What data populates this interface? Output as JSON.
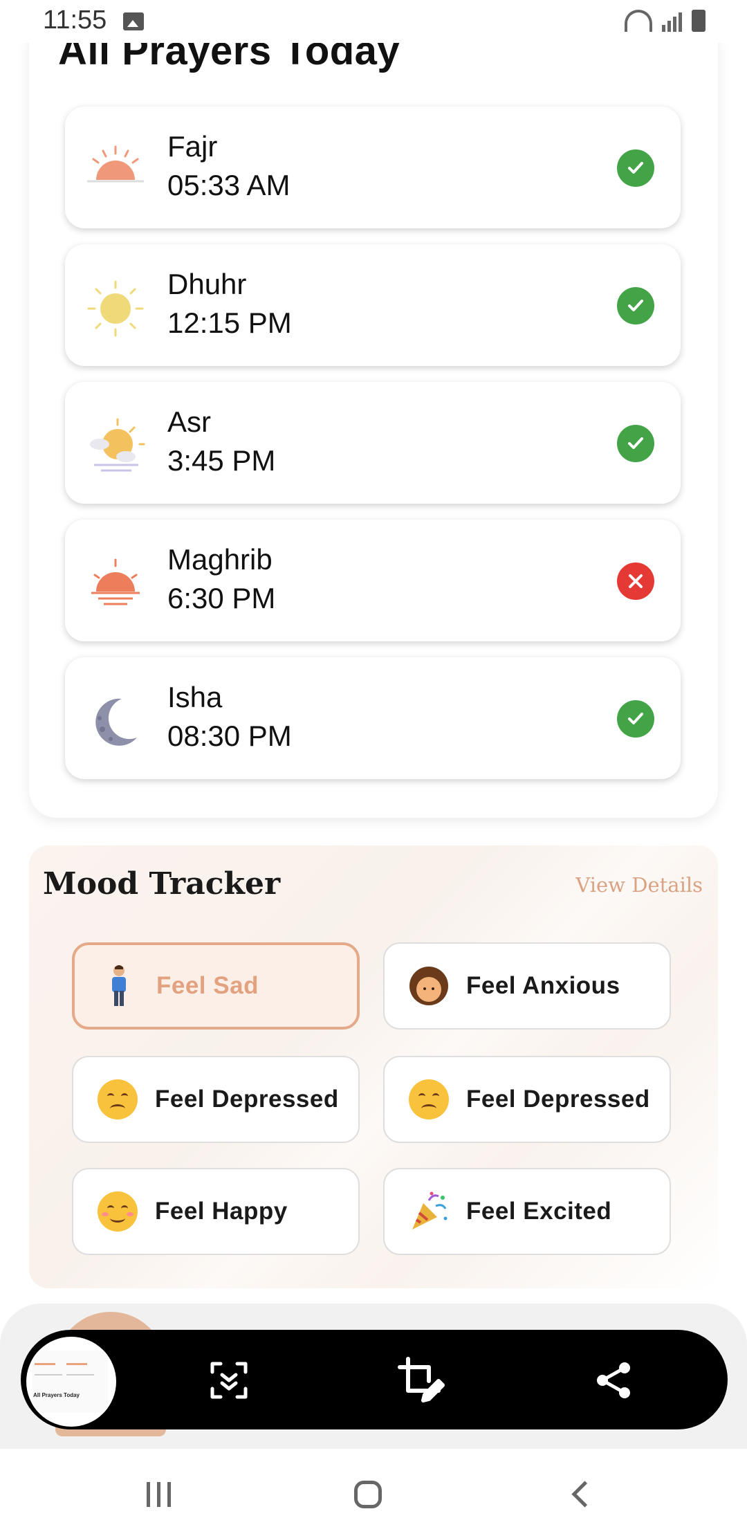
{
  "status_bar": {
    "time": "11:55"
  },
  "prayers": {
    "title": "All Prayers Today",
    "items": [
      {
        "name": "Fajr",
        "time": "05:33 AM",
        "icon": "sunrise-icon",
        "status": "done"
      },
      {
        "name": "Dhuhr",
        "time": "12:15 PM",
        "icon": "sun-icon",
        "status": "done"
      },
      {
        "name": "Asr",
        "time": "3:45 PM",
        "icon": "sun-cloud-icon",
        "status": "done"
      },
      {
        "name": "Maghrib",
        "time": "6:30 PM",
        "icon": "sunset-icon",
        "status": "missed"
      },
      {
        "name": "Isha",
        "time": "08:30 PM",
        "icon": "moon-icon",
        "status": "done"
      }
    ]
  },
  "mood": {
    "title": "Mood Tracker",
    "view_details": "View Details",
    "options": [
      {
        "label": "Feel Sad",
        "emoji": "person-standing-icon",
        "selected": true
      },
      {
        "label": "Feel Anxious",
        "emoji": "person-face-icon",
        "selected": false
      },
      {
        "label": "Feel Depressed",
        "emoji": "disappointed-face-icon",
        "selected": false
      },
      {
        "label": "Feel Depressed",
        "emoji": "disappointed-face-icon",
        "selected": false
      },
      {
        "label": "Feel Happy",
        "emoji": "smiling-face-icon",
        "selected": false
      },
      {
        "label": "Feel Excited",
        "emoji": "party-popper-icon",
        "selected": false
      }
    ]
  },
  "toolbar": {
    "thumbnail_text": "All Prayers Today",
    "icons": [
      "scroll-capture-icon",
      "crop-edit-icon",
      "share-icon"
    ]
  },
  "colors": {
    "accent": "#e2a27f",
    "success": "#43a447",
    "error": "#e53935"
  }
}
